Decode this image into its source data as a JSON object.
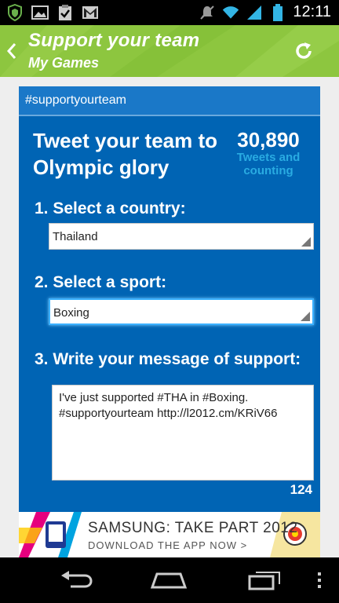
{
  "status_bar": {
    "time": "12:11",
    "left_icons": [
      "shield-icon",
      "image-icon",
      "clipboard-check-icon",
      "gmail-icon"
    ],
    "right_icons": [
      "mute-icon",
      "wifi-icon",
      "signal-icon",
      "battery-icon"
    ]
  },
  "app_bar": {
    "title": "Support your team",
    "subtitle": "My Games",
    "color": "#8dc63f"
  },
  "card": {
    "hashtag": "#supportyourteam",
    "headline": "Tweet your team to Olympic glory",
    "counter_value": "30,890",
    "counter_label": "Tweets and counting",
    "step1_label": "1. Select a country:",
    "country_value": "Thailand",
    "step2_label": "2. Select a sport:",
    "sport_value": "Boxing",
    "step3_label": "3. Write your message of support:",
    "message_text": "I've just supported #THA in #Boxing. #supportyourteam http://l2012.cm/KRiV66",
    "char_count": "124",
    "color": "#0064b4",
    "accent": "#29abe2"
  },
  "ad": {
    "title": "SAMSUNG: TAKE PART 2012",
    "subtitle": "DOWNLOAD THE APP NOW >"
  },
  "nav_bar": {
    "buttons": [
      "back-icon",
      "home-icon",
      "recent-apps-icon",
      "menu-icon"
    ]
  }
}
